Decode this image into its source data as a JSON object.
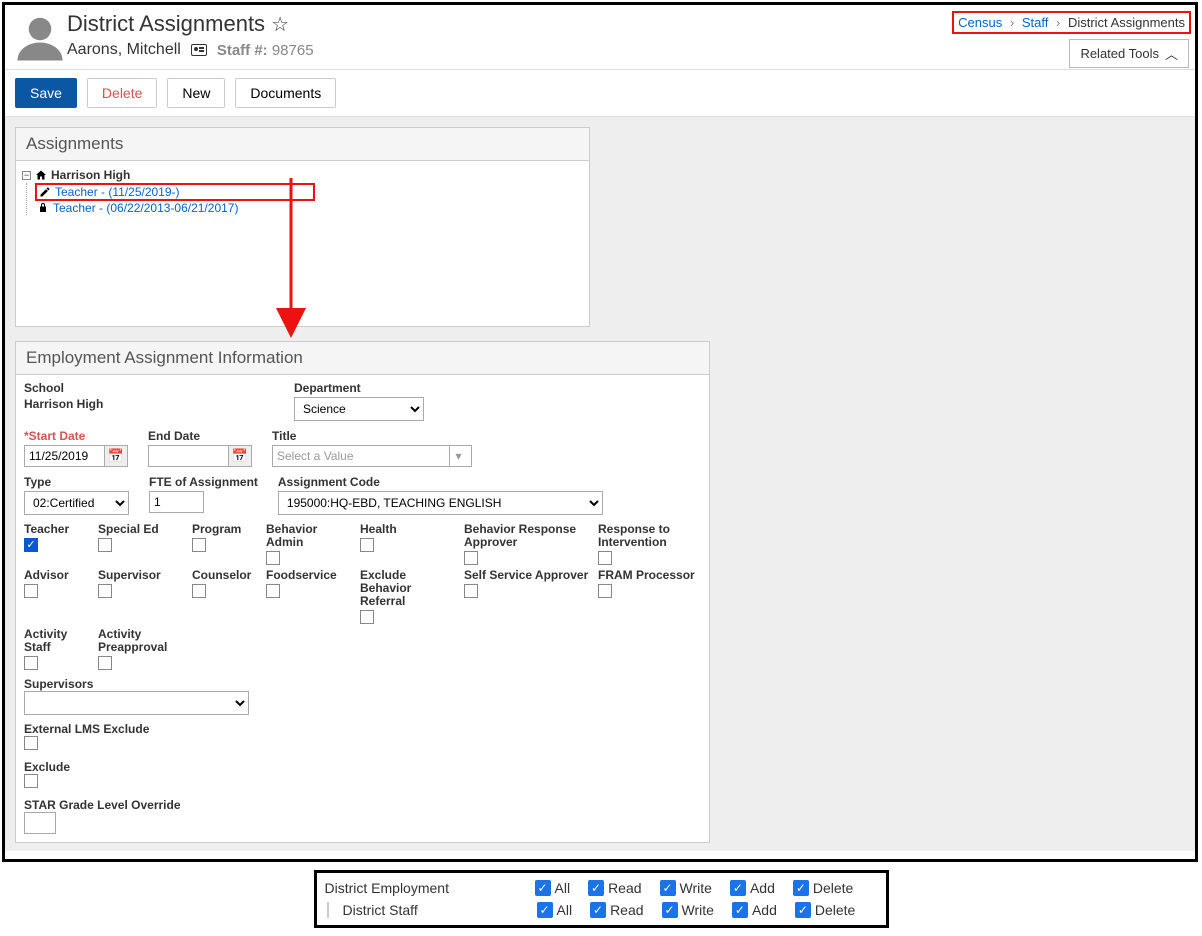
{
  "header": {
    "page_title": "District Assignments",
    "person_name": "Aarons, Mitchell",
    "staff_label": "Staff #:",
    "staff_number": "98765",
    "related_tools": "Related Tools"
  },
  "breadcrumb": {
    "item1": "Census",
    "item2": "Staff",
    "item3": "District Assignments"
  },
  "toolbar": {
    "save": "Save",
    "delete": "Delete",
    "new": "New",
    "documents": "Documents"
  },
  "assignments_panel": {
    "title": "Assignments",
    "school": "Harrison High",
    "item_selected": "Teacher - (11/25/2019-)",
    "item_prev": "Teacher - (06/22/2013-06/21/2017)"
  },
  "employment": {
    "title": "Employment Assignment Information",
    "labels": {
      "school": "School",
      "department": "Department",
      "start_date": "Start Date",
      "end_date": "End Date",
      "title": "Title",
      "type": "Type",
      "fte": "FTE of Assignment",
      "code": "Assignment Code",
      "supervisors": "Supervisors",
      "ext_lms": "External LMS Exclude",
      "exclude": "Exclude",
      "star": "STAR Grade Level Override"
    },
    "values": {
      "school": "Harrison High",
      "department": "Science",
      "start_date": "11/25/2019",
      "end_date": "",
      "title_placeholder": "Select a Value",
      "type": "02:Certified",
      "fte": "1",
      "code": "195000:HQ-EBD, TEACHING ENGLISH"
    },
    "roles_row1": {
      "teacher": "Teacher",
      "special_ed": "Special Ed",
      "program": "Program",
      "behavior_admin": "Behavior Admin",
      "health": "Health",
      "bra": "Behavior Response Approver",
      "rti": "Response to Intervention"
    },
    "roles_row2": {
      "advisor": "Advisor",
      "supervisor": "Supervisor",
      "counselor": "Counselor",
      "foodservice": "Foodservice",
      "exclude_behavior": "Exclude Behavior Referral",
      "ssa": "Self Service Approver",
      "fram": "FRAM Processor"
    },
    "roles_row3": {
      "activity_staff": "Activity Staff",
      "activity_preapproval": "Activity Preapproval"
    }
  },
  "permissions": {
    "row1_label": "District Employment",
    "row2_label": "District Staff",
    "cols": {
      "all": "All",
      "read": "Read",
      "write": "Write",
      "add": "Add",
      "delete": "Delete"
    }
  }
}
